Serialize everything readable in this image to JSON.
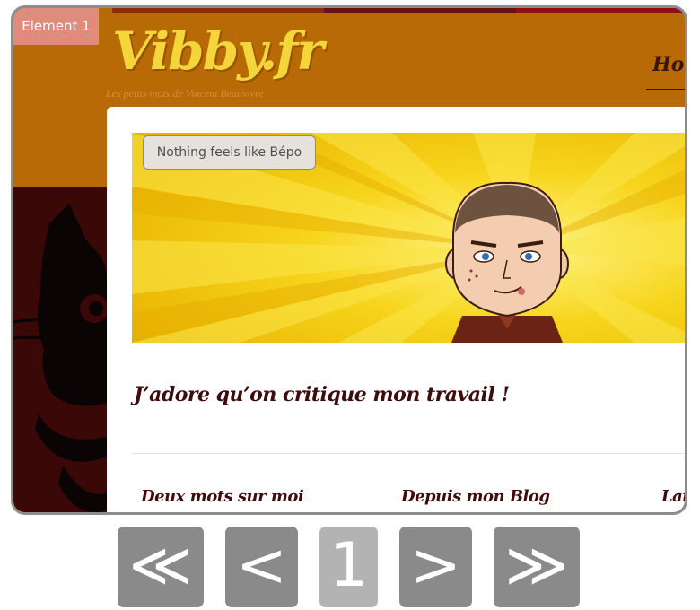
{
  "overlay": {
    "element_label": "Element 1"
  },
  "site": {
    "logo": "Vibby.fr",
    "tagline": "Les petits mots de Vincent Beauvivre",
    "nav_home": "Hon"
  },
  "banner": {
    "tooltip": "Nothing feels like Bépo"
  },
  "post": {
    "title": "J’adore qu’on critique mon travail !"
  },
  "footer_columns": [
    "Deux mots sur moi",
    "Depuis mon Blog",
    "Lat"
  ],
  "pagination": {
    "first": "≪",
    "prev": "<",
    "current": "1",
    "next": ">",
    "last": "≫"
  },
  "colors": {
    "header_bg": "#b86a07",
    "logo": "#f5d63a",
    "sidebar": "#3b0808",
    "heading_text": "#3d0d0d",
    "pager_button": "#8a8a8a",
    "pager_current": "#b3b3b3"
  }
}
